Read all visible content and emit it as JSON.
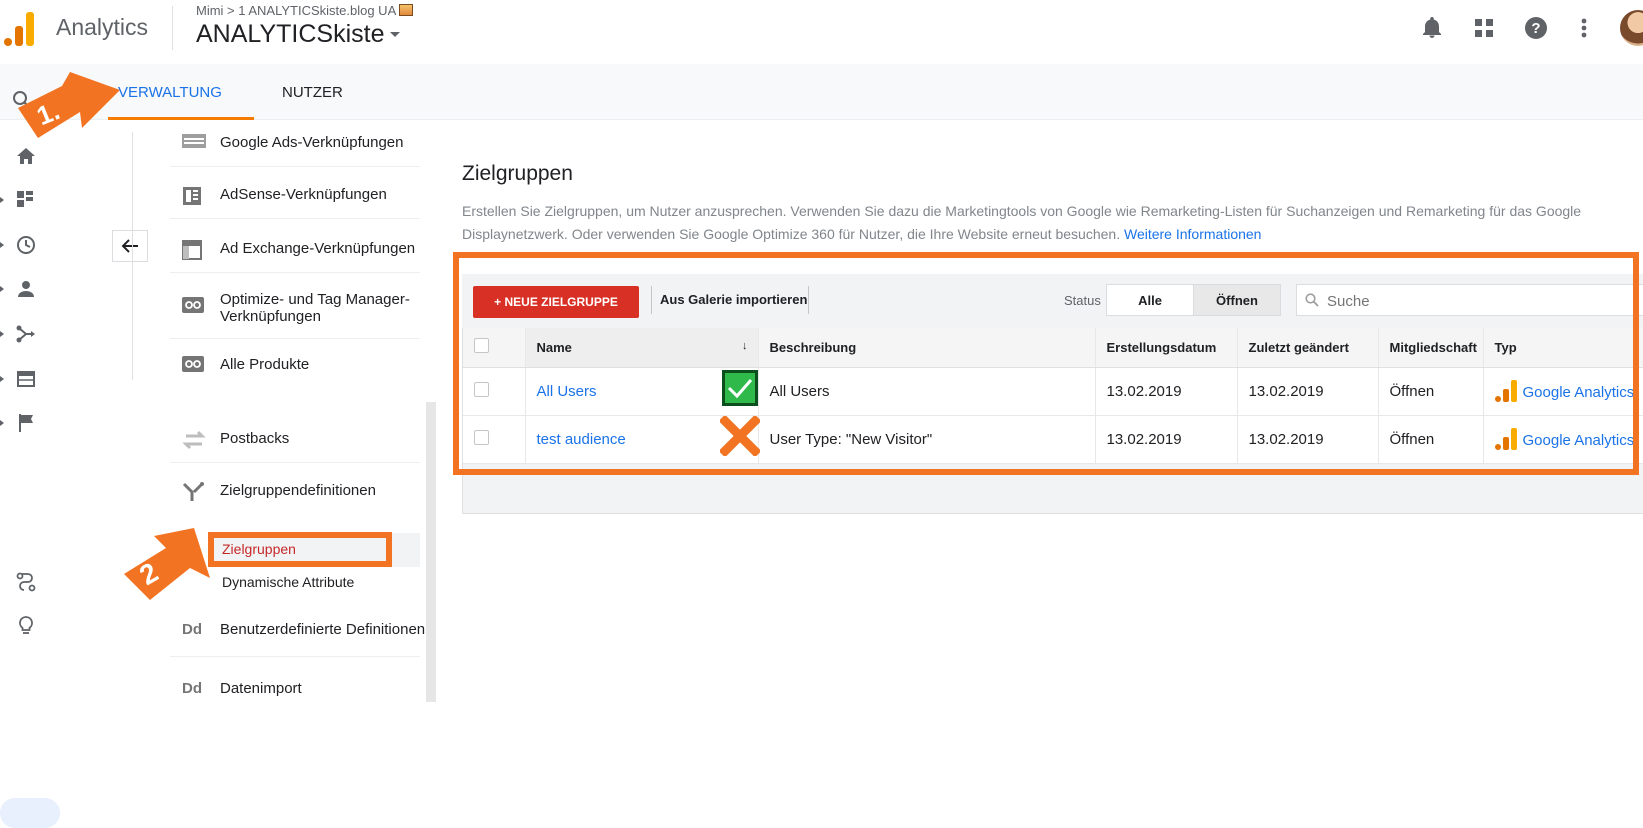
{
  "header": {
    "app_name": "Analytics",
    "breadcrumb": "Mimi > 1 ANALYTICSkiste.blog UA",
    "account": "ANALYTICSkiste"
  },
  "icons": {
    "notifications": "bell-icon",
    "apps": "apps-grid-icon",
    "help": "help-icon",
    "more": "more-vert-icon",
    "search": "search-icon",
    "back": "arrow-left-icon"
  },
  "tabs": [
    {
      "label": "VERWALTUNG",
      "active": true
    },
    {
      "label": "NUTZER",
      "active": false
    }
  ],
  "menu": {
    "items": [
      {
        "label": "Google Ads-Verknüpfungen",
        "icon": "ads-link-icon"
      },
      {
        "label": "AdSense-Verknüpfungen",
        "icon": "adsense-link-icon"
      },
      {
        "label": "Ad Exchange-Verknüpfungen",
        "icon": "adexchange-link-icon"
      },
      {
        "label": "Optimize- und Tag Manager-\nVerknüpfungen",
        "icon": "product-link-icon"
      },
      {
        "label": "Alle Produkte",
        "icon": "product-link-icon"
      },
      {
        "label": "Postbacks",
        "icon": "postbacks-icon"
      },
      {
        "label": "Zielgruppendefinitionen",
        "icon": "audience-definitions-icon"
      },
      {
        "label": "Benutzerdefinierte Definitionen",
        "icon": "dd-icon",
        "icon_text": "Dd"
      },
      {
        "label": "Datenimport",
        "icon": "dd-icon",
        "icon_text": "Dd"
      }
    ],
    "subitems": [
      {
        "label": "Zielgruppen",
        "selected": true
      },
      {
        "label": "Dynamische Attribute",
        "selected": false
      }
    ]
  },
  "content": {
    "title": "Zielgruppen",
    "description": "Erstellen Sie Zielgruppen, um Nutzer anzusprechen. Verwenden Sie dazu die Marketingtools von Google wie Remarketing-Listen für Suchanzeigen und Remarketing für das Google Displaynetzwerk. Oder verwenden Sie Google Optimize 360 für Nutzer, die Ihre Website erneut besuchen.",
    "more_link": "Weitere Informationen"
  },
  "toolbar": {
    "new_button": "+ NEUE ZIELGRUPPE",
    "import_button": "Aus Galerie importieren",
    "status_label": "Status",
    "status_options": [
      "Alle",
      "Öffnen"
    ],
    "status_selected": "Öffnen",
    "search_placeholder": "Suche"
  },
  "table": {
    "columns": [
      "Name",
      "Beschreibung",
      "Erstellungsdatum",
      "Zuletzt geändert",
      "Mitgliedschaft",
      "Typ"
    ],
    "sort_indicator": "↓",
    "rows": [
      {
        "name": "All Users",
        "description": "All Users",
        "created": "13.02.2019",
        "modified": "13.02.2019",
        "membership": "Öffnen",
        "type": "Google Analytics",
        "mark": "check"
      },
      {
        "name": "test audience",
        "description": "User Type: \"New Visitor\"",
        "created": "13.02.2019",
        "modified": "13.02.2019",
        "membership": "Öffnen",
        "type": "Google Analytics",
        "mark": "cross"
      }
    ]
  },
  "annotations": {
    "step1": "1.",
    "step2": "2"
  },
  "colors": {
    "accent_blue": "#1a73e8",
    "new_button_red": "#d93025",
    "annotation_orange": "#f27321",
    "selected_red": "#c62828",
    "check_green": "#2fb94a",
    "ga_orange": "#f9ab00",
    "ga_dark_orange": "#e37400"
  }
}
